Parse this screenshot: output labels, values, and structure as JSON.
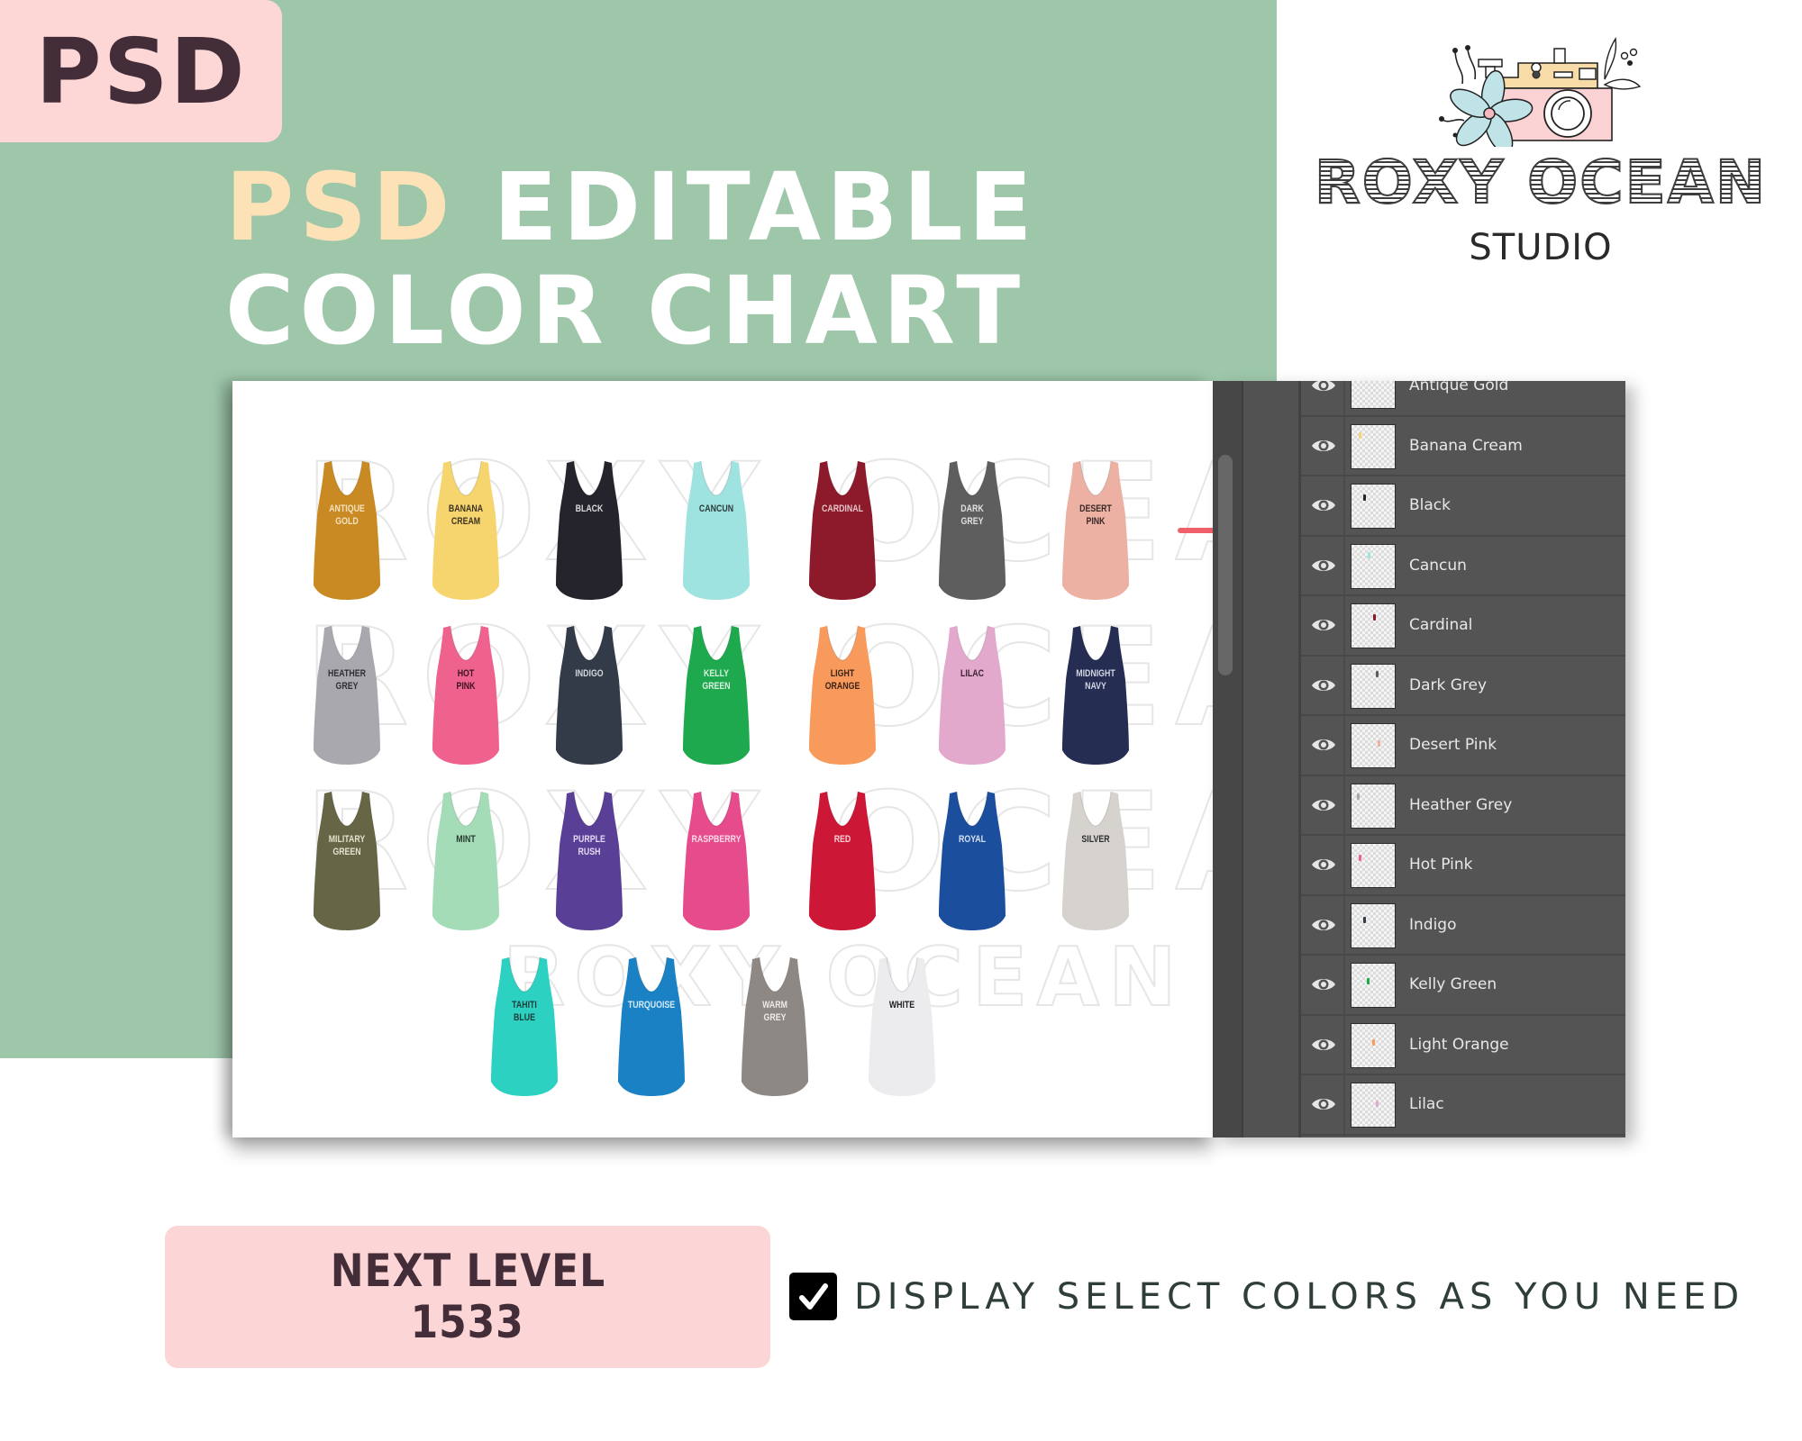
{
  "badge": {
    "label": "PSD"
  },
  "title": {
    "line1_accent": "PSD",
    "line1_rest": "EDITABLE",
    "line2": "COLOR CHART"
  },
  "logo": {
    "name": "ROXY OCEAN",
    "subtitle": "STUDIO",
    "icon": "camera-with-flower-icon"
  },
  "canvas": {
    "watermark": "ROXY OCEAN",
    "tanks": [
      {
        "label": "ANTIQUE GOLD",
        "lines": [
          "ANTIQUE",
          "GOLD"
        ],
        "color": "#c98a24",
        "text_color": "#f3e2bf",
        "row": 0,
        "col": 0
      },
      {
        "label": "BANANA CREAM",
        "lines": [
          "BANANA",
          "CREAM"
        ],
        "color": "#f7d56e",
        "text_color": "#3a3320",
        "row": 0,
        "col": 1
      },
      {
        "label": "BLACK",
        "lines": [
          "BLACK"
        ],
        "color": "#25242c",
        "text_color": "#d9d9d9",
        "row": 0,
        "col": 2
      },
      {
        "label": "CANCUN",
        "lines": [
          "CANCUN"
        ],
        "color": "#9fe3e0",
        "text_color": "#2b3a3a",
        "row": 0,
        "col": 3
      },
      {
        "label": "CARDINAL",
        "lines": [
          "CARDINAL"
        ],
        "color": "#8c1a2b",
        "text_color": "#e6c3c6",
        "row": 0,
        "col": 4
      },
      {
        "label": "DARK GREY",
        "lines": [
          "DARK",
          "GREY"
        ],
        "color": "#5e5e5e",
        "text_color": "#e0e0e0",
        "row": 0,
        "col": 5
      },
      {
        "label": "DESERT PINK",
        "lines": [
          "DESERT",
          "PINK"
        ],
        "color": "#ecb1a2",
        "text_color": "#3a2a27",
        "row": 0,
        "col": 6
      },
      {
        "label": "HEATHER GREY",
        "lines": [
          "HEATHER",
          "GREY"
        ],
        "color": "#a9a8ae",
        "text_color": "#2f2f33",
        "row": 1,
        "col": 0
      },
      {
        "label": "HOT PINK",
        "lines": [
          "HOT",
          "PINK"
        ],
        "color": "#f0628e",
        "text_color": "#3b1522",
        "row": 1,
        "col": 1
      },
      {
        "label": "INDIGO",
        "lines": [
          "INDIGO"
        ],
        "color": "#333a48",
        "text_color": "#d4d6dc",
        "row": 1,
        "col": 2
      },
      {
        "label": "KELLY GREEN",
        "lines": [
          "KELLY",
          "GREEN"
        ],
        "color": "#1ea94f",
        "text_color": "#d8f0de",
        "row": 1,
        "col": 3
      },
      {
        "label": "LIGHT ORANGE",
        "lines": [
          "LIGHT",
          "ORANGE"
        ],
        "color": "#f79a5c",
        "text_color": "#3b2314",
        "row": 1,
        "col": 4
      },
      {
        "label": "LILAC",
        "lines": [
          "LILAC"
        ],
        "color": "#e3a9cc",
        "text_color": "#3a2433",
        "row": 1,
        "col": 5
      },
      {
        "label": "MIDNIGHT NAVY",
        "lines": [
          "MIDNIGHT",
          "NAVY"
        ],
        "color": "#252d52",
        "text_color": "#d2d5e2",
        "row": 1,
        "col": 6
      },
      {
        "label": "MILITARY GREEN",
        "lines": [
          "MILITARY",
          "GREEN"
        ],
        "color": "#666545",
        "text_color": "#e2e1cf",
        "row": 2,
        "col": 0
      },
      {
        "label": "MINT",
        "lines": [
          "MINT"
        ],
        "color": "#a5dcb8",
        "text_color": "#273a2e",
        "row": 2,
        "col": 1
      },
      {
        "label": "PURPLE RUSH",
        "lines": [
          "PURPLE",
          "RUSH"
        ],
        "color": "#5a3f96",
        "text_color": "#e3daf2",
        "row": 2,
        "col": 2
      },
      {
        "label": "RASPBERRY",
        "lines": [
          "RASPBERRY"
        ],
        "color": "#e64b8c",
        "text_color": "#fbdbe8",
        "row": 2,
        "col": 3
      },
      {
        "label": "RED",
        "lines": [
          "RED"
        ],
        "color": "#cc1736",
        "text_color": "#f6d0d6",
        "row": 2,
        "col": 4
      },
      {
        "label": "ROYAL",
        "lines": [
          "ROYAL"
        ],
        "color": "#1b4f9e",
        "text_color": "#d6e0f2",
        "row": 2,
        "col": 5
      },
      {
        "label": "SILVER",
        "lines": [
          "SILVER"
        ],
        "color": "#d6d3cf",
        "text_color": "#2e2e2e",
        "row": 2,
        "col": 6
      },
      {
        "label": "TAHITI BLUE",
        "lines": [
          "TAHITI",
          "BLUE"
        ],
        "color": "#2dd1c2",
        "text_color": "#1f3b38",
        "row": 3,
        "col": 0
      },
      {
        "label": "TURQUOISE",
        "lines": [
          "TURQUOISE"
        ],
        "color": "#1a82c4",
        "text_color": "#d5ebf7",
        "row": 3,
        "col": 1
      },
      {
        "label": "WARM GREY",
        "lines": [
          "WARM",
          "GREY"
        ],
        "color": "#8d8883",
        "text_color": "#ecebea",
        "row": 3,
        "col": 2
      },
      {
        "label": "WHITE",
        "lines": [
          "WHITE"
        ],
        "color": "#ececee",
        "text_color": "#222222",
        "row": 3,
        "col": 3
      }
    ]
  },
  "arrow": {
    "icon": "arrow-right-icon",
    "color": "#f0606a"
  },
  "layers_panel": {
    "layers": [
      {
        "name": "Antique Gold",
        "visible": true,
        "swatch": "#c98a24"
      },
      {
        "name": "Banana Cream",
        "visible": true,
        "swatch": "#f7d56e"
      },
      {
        "name": "Black",
        "visible": true,
        "swatch": "#25242c"
      },
      {
        "name": "Cancun",
        "visible": true,
        "swatch": "#9fe3e0"
      },
      {
        "name": "Cardinal",
        "visible": true,
        "swatch": "#8c1a2b"
      },
      {
        "name": "Dark Grey",
        "visible": true,
        "swatch": "#5e5e5e"
      },
      {
        "name": "Desert Pink",
        "visible": true,
        "swatch": "#ecb1a2"
      },
      {
        "name": "Heather Grey",
        "visible": true,
        "swatch": "#a9a8ae"
      },
      {
        "name": "Hot Pink",
        "visible": true,
        "swatch": "#f0628e"
      },
      {
        "name": "Indigo",
        "visible": true,
        "swatch": "#333a48"
      },
      {
        "name": "Kelly Green",
        "visible": true,
        "swatch": "#1ea94f"
      },
      {
        "name": "Light Orange",
        "visible": true,
        "swatch": "#f79a5c"
      },
      {
        "name": "Lilac",
        "visible": true,
        "swatch": "#e3a9cc"
      }
    ]
  },
  "model": {
    "line1": "NEXT LEVEL",
    "line2": "1533"
  },
  "feature": {
    "checked": true,
    "text": "DISPLAY SELECT COLORS AS YOU NEED"
  },
  "colors": {
    "green": "#9ec7aa",
    "pink": "#fdd6d6",
    "accent_title": "#fde2b8",
    "dark": "#432d38"
  }
}
